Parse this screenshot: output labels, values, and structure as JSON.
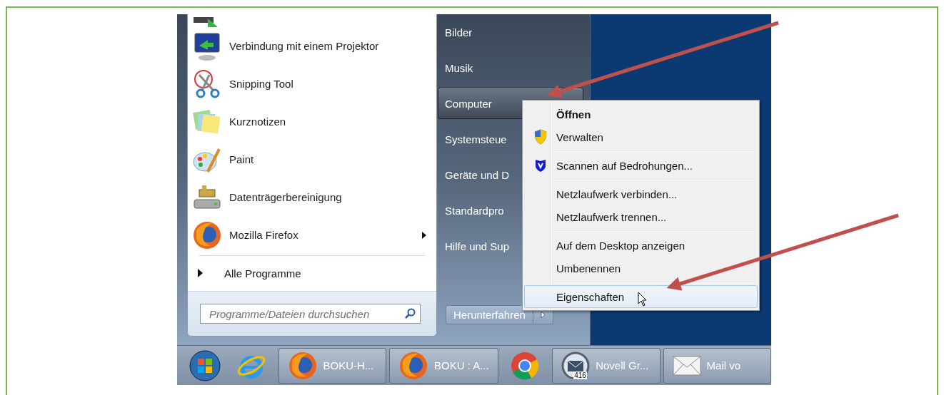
{
  "start_menu": {
    "programs": [
      {
        "label": "Verbindung mit einem Projektor",
        "submenu": false
      },
      {
        "label": "Snipping Tool",
        "submenu": false
      },
      {
        "label": "Kurznotizen",
        "submenu": false
      },
      {
        "label": "Paint",
        "submenu": false
      },
      {
        "label": "Datenträgerbereinigung",
        "submenu": false
      },
      {
        "label": "Mozilla Firefox",
        "submenu": true
      }
    ],
    "all_programs": {
      "label": "Alle Programme"
    },
    "search": {
      "placeholder": "Programme/Dateien durchsuchen"
    },
    "places": [
      {
        "label": "Bilder",
        "selected": false
      },
      {
        "label": "Musik",
        "selected": false
      },
      {
        "label": "Computer",
        "selected": true
      },
      {
        "label": "Systemsteue",
        "selected": false
      },
      {
        "label": "Geräte und D",
        "selected": false
      },
      {
        "label": "Standardpro",
        "selected": false
      },
      {
        "label": "Hilfe und Sup",
        "selected": false
      }
    ],
    "shutdown": {
      "label": "Herunterfahren"
    }
  },
  "context_menu": {
    "groups": [
      [
        {
          "label": "Öffnen",
          "default": true,
          "selected": false
        },
        {
          "label": "Verwalten",
          "default": false,
          "selected": false
        }
      ],
      [
        {
          "label": "Scannen auf Bedrohungen...",
          "default": false,
          "selected": false
        }
      ],
      [
        {
          "label": "Netzlaufwerk verbinden...",
          "default": false,
          "selected": false
        },
        {
          "label": "Netzlaufwerk trennen...",
          "default": false,
          "selected": false
        }
      ],
      [
        {
          "label": "Auf dem Desktop anzeigen",
          "default": false,
          "selected": false
        },
        {
          "label": "Umbenennen",
          "default": false,
          "selected": false
        }
      ],
      [
        {
          "label": "Eigenschaften",
          "default": false,
          "selected": true
        }
      ]
    ]
  },
  "taskbar": {
    "items": [
      {
        "kind": "start"
      },
      {
        "kind": "app"
      },
      {
        "kind": "window",
        "label": "BOKU-H..."
      },
      {
        "kind": "window",
        "label": "BOKU : A..."
      },
      {
        "kind": "app"
      },
      {
        "kind": "window",
        "label": "Novell Gr...",
        "badge": "416"
      },
      {
        "kind": "window",
        "label": "Mail vo"
      }
    ]
  }
}
